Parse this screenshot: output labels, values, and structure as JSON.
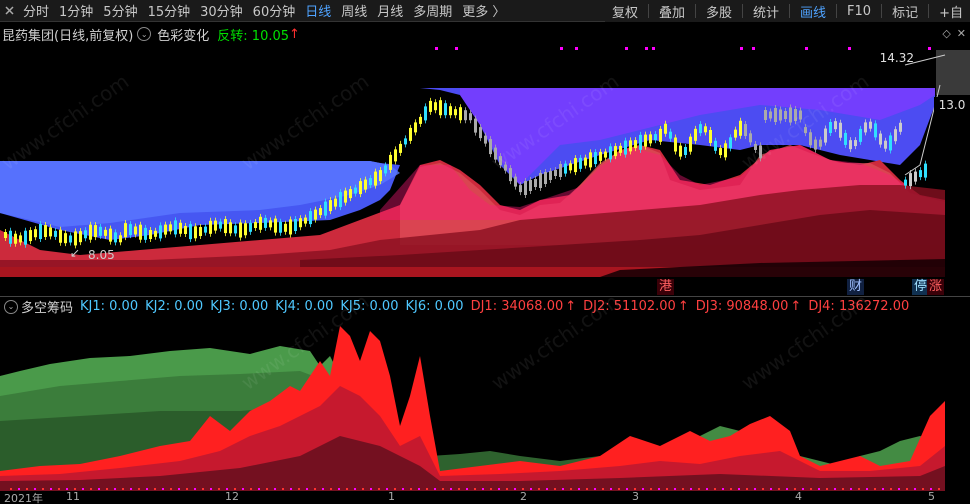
{
  "toolbar": {
    "left_items": [
      "分时",
      "1分钟",
      "5分钟",
      "15分钟",
      "30分钟",
      "60分钟",
      "日线",
      "周线",
      "月线",
      "多周期",
      "更多 〉"
    ],
    "active": "日线",
    "right_items": [
      "复权",
      "叠加",
      "多股",
      "统计",
      "画线",
      "F10",
      "标记",
      "+自"
    ],
    "right_active": "画线"
  },
  "title": {
    "stock": "昆药集团(日线,前复权)",
    "indicator": "色彩变化",
    "reversal": "反转: 10.05",
    "up_arrow": "↑"
  },
  "price_labels": {
    "high": "14.32",
    "right_axis": "13.0",
    "low": "8.05"
  },
  "markers": {
    "gang": "港",
    "cai": "财",
    "ting": "停",
    "zhang": "涨"
  },
  "sub_indicator": {
    "name": "多空筹码",
    "kj": [
      "KJ1: 0.00",
      "KJ2: 0.00",
      "KJ3: 0.00",
      "KJ4: 0.00",
      "KJ5: 0.00",
      "KJ6: 0.00"
    ],
    "dj": [
      "DJ1: 34068.00",
      "DJ2: 51102.00",
      "DJ3: 90848.00",
      "DJ4: 136272.00"
    ],
    "arrow": "↑"
  },
  "date_axis": [
    "2021年",
    "11",
    "12",
    "1",
    "2",
    "3",
    "4",
    "5"
  ],
  "watermark": "www.cfchi.com",
  "colors": {
    "active": "#4fa3ff",
    "blue_band": "#5a64ff",
    "purple_band": "#7a3cff",
    "red_main": "#e0283c",
    "dark_red": "#8a1020",
    "green_area": "#4a9a4a",
    "bright_red": "#ff2020",
    "magenta": "#ff00ff",
    "yellow_bar": "#ffff30",
    "cyan_bar": "#30e0ff"
  }
}
